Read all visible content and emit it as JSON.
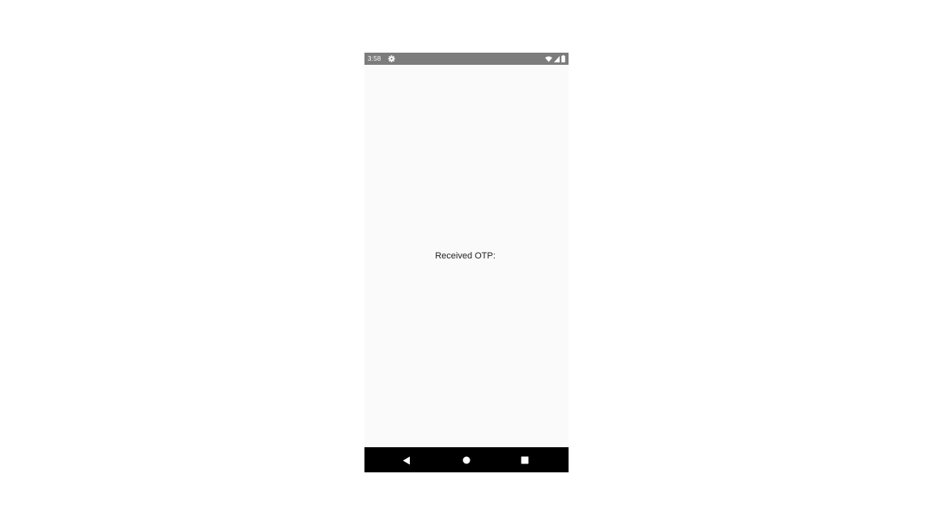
{
  "status_bar": {
    "time": "3:58",
    "icons": [
      "gear-icon",
      "wifi-icon",
      "signal-icon",
      "battery-icon"
    ]
  },
  "main": {
    "otp_label": "Received OTP:"
  },
  "nav_bar": {
    "buttons": [
      "back-icon",
      "home-icon",
      "recents-icon"
    ]
  },
  "colors": {
    "status_bar_bg": "#7c7c7c",
    "screen_bg": "#fafafa",
    "nav_bar_bg": "#000000",
    "text": "#1e1e1e"
  }
}
